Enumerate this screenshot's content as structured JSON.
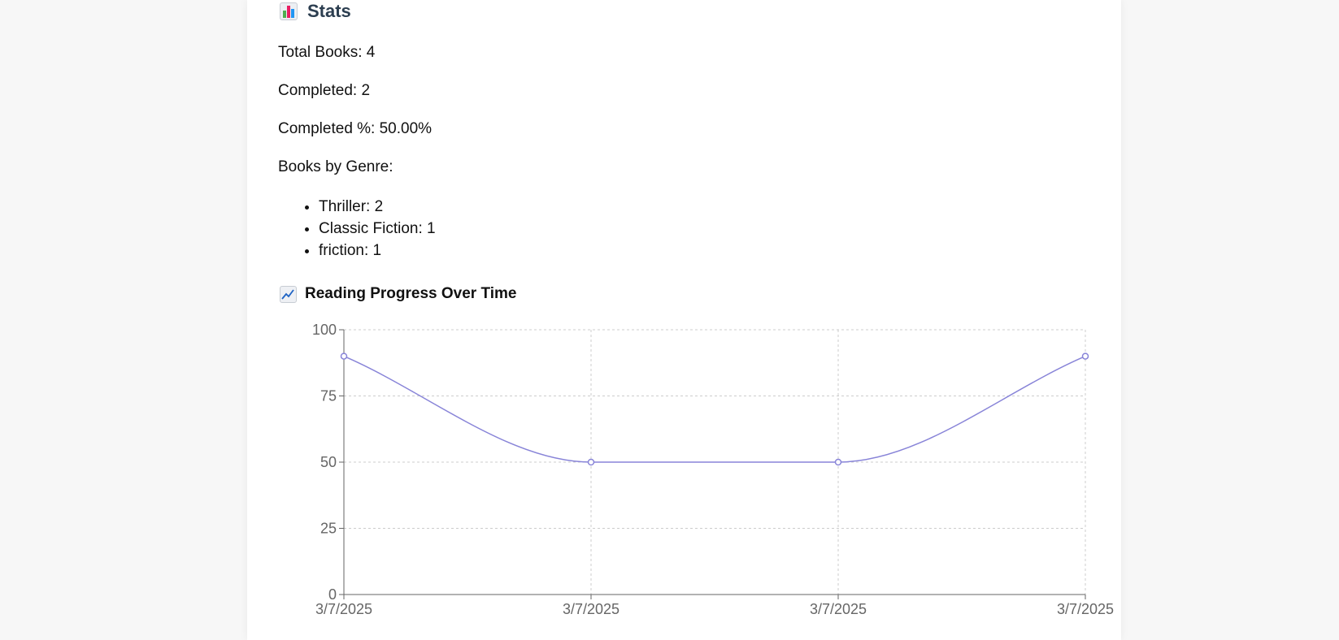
{
  "stats": {
    "title": "Stats",
    "total_books": "Total Books: 4",
    "completed": "Completed: 2",
    "completed_pct": "Completed %: 50.00%",
    "by_genre_label": "Books by Genre:",
    "genres": [
      "Thriller: 2",
      "Classic Fiction: 1",
      "friction: 1"
    ]
  },
  "chart_heading": "Reading Progress Over Time",
  "icons": {
    "stats": "bar-chart-icon",
    "progress": "line-chart-icon"
  },
  "colors": {
    "line": "#8884d8",
    "grid": "#cccccc",
    "axis": "#666666",
    "title": "#2c3e50"
  },
  "chart_data": {
    "type": "line",
    "categories": [
      "3/7/2025",
      "3/7/2025",
      "3/7/2025",
      "3/7/2025"
    ],
    "values": [
      90,
      50,
      50,
      90
    ],
    "yticks": [
      0,
      25,
      50,
      75,
      100
    ],
    "ylim": [
      0,
      100
    ],
    "title": "",
    "xlabel": "",
    "ylabel": "",
    "grid": true,
    "curve": "monotone"
  }
}
